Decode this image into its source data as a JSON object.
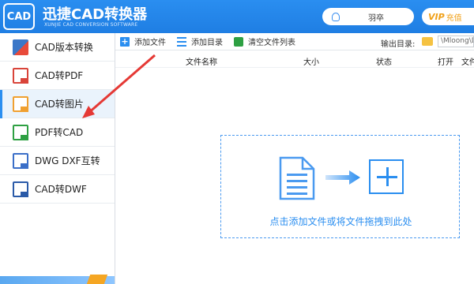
{
  "app": {
    "logo": "CAD",
    "title": "迅捷CAD转换器",
    "subtitle": "XUNJIE CAD CONVERSION SOFTWARE",
    "user": "羽卒",
    "vip_badge": "VIP",
    "vip_text": "充值"
  },
  "sidebar": {
    "items": [
      {
        "label": "CAD版本转换",
        "icon": "cad-version-icon"
      },
      {
        "label": "CAD转PDF",
        "icon": "cad-to-pdf-icon"
      },
      {
        "label": "CAD转图片",
        "icon": "cad-to-image-icon"
      },
      {
        "label": "PDF转CAD",
        "icon": "pdf-to-cad-icon"
      },
      {
        "label": "DWG DXF互转",
        "icon": "dwg-dxf-icon"
      },
      {
        "label": "CAD转DWF",
        "icon": "cad-to-dwf-icon"
      }
    ],
    "active_index": 2
  },
  "toolbar": {
    "add_file": "添加文件",
    "add_folder": "添加目录",
    "clear_list": "清空文件列表",
    "output_label": "输出目录:",
    "output_path": "\\Mloong\\De"
  },
  "table": {
    "columns": [
      "文件名称",
      "大小",
      "状态",
      "打开",
      "文件"
    ]
  },
  "dropzone": {
    "text": "点击添加文件或将文件拖拽到此处"
  },
  "colors": {
    "accent": "#2a8ef0",
    "annotation": "#e53935",
    "vip": "#f0a018"
  }
}
